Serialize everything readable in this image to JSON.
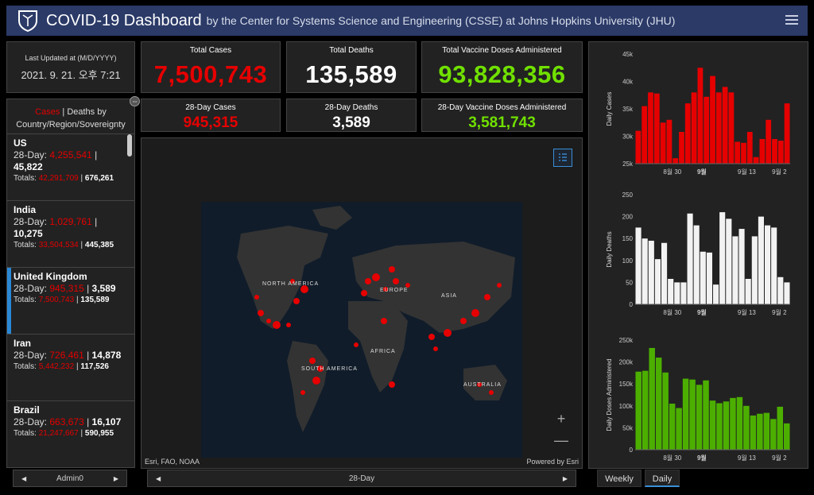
{
  "header": {
    "title": "COVID-19 Dashboard",
    "subtitle": "by the Center for Systems Science and Engineering (CSSE) at Johns Hopkins University (JHU)"
  },
  "last_updated": {
    "label": "Last Updated at (M/D/YYYY)",
    "value": "2021. 9. 21. 오후 7:21"
  },
  "stats": {
    "total_cases": {
      "label": "Total Cases",
      "value": "7,500,743"
    },
    "total_deaths": {
      "label": "Total Deaths",
      "value": "135,589"
    },
    "total_vaccine": {
      "label": "Total Vaccine Doses Administered",
      "value": "93,828,356"
    },
    "cases_28": {
      "label": "28-Day Cases",
      "value": "945,315"
    },
    "deaths_28": {
      "label": "28-Day Deaths",
      "value": "3,589"
    },
    "vaccine_28": {
      "label": "28-Day Vaccine Doses Administered",
      "value": "3,581,743"
    }
  },
  "list": {
    "header_cases": "Cases",
    "header_rest": " | Deaths by Country/Region/Sovereignty",
    "countries": [
      {
        "name": "US",
        "day28_label": "28-Day: ",
        "day28_cases": "4,255,541",
        "day28_deaths": "45,822",
        "totals_label": "Totals: ",
        "total_cases": "42,291,709",
        "total_deaths": "676,261"
      },
      {
        "name": "India",
        "day28_label": "28-Day: ",
        "day28_cases": "1,029,761",
        "day28_deaths": "10,275",
        "totals_label": "Totals: ",
        "total_cases": "33,504,534",
        "total_deaths": "445,385"
      },
      {
        "name": "United Kingdom",
        "day28_label": "28-Day: ",
        "day28_cases": "945,315",
        "day28_deaths": "3,589",
        "totals_label": "Totals: ",
        "total_cases": "7,500,743",
        "total_deaths": "135,589"
      },
      {
        "name": "Iran",
        "day28_label": "28-Day: ",
        "day28_cases": "726,461",
        "day28_deaths": "14,878",
        "totals_label": "Totals: ",
        "total_cases": "5,442,232",
        "total_deaths": "117,526"
      },
      {
        "name": "Brazil",
        "day28_label": "28-Day: ",
        "day28_cases": "663,673",
        "day28_deaths": "16,107",
        "totals_label": "Totals: ",
        "total_cases": "21,247,667",
        "total_deaths": "590,955"
      }
    ]
  },
  "left_pager": {
    "label": "Admin0"
  },
  "map_pager": {
    "label": "28-Day"
  },
  "map": {
    "labels": [
      "NORTH AMERICA",
      "EUROPE",
      "ASIA",
      "AFRICA",
      "SOUTH AMERICA",
      "AUSTRALIA"
    ],
    "attribution": "Esri, FAO, NOAA",
    "powered_by": "Powered by Esri",
    "zoom_in": "+",
    "zoom_out": "—"
  },
  "tabs": {
    "weekly": "Weekly",
    "daily": "Daily"
  },
  "colors": {
    "cases": "#e60000",
    "deaths": "#f2f2f2",
    "vaccines": "#4caf00",
    "header": "#2b3a67",
    "accent": "#2a88d6"
  },
  "chart_data": [
    {
      "type": "bar",
      "ylabel": "Daily Cases",
      "ylim": [
        25000,
        45000
      ],
      "yticks": [
        "25k",
        "30k",
        "35k",
        "40k",
        "45k"
      ],
      "xticks": [
        "8월 30",
        "9월",
        "9월 13",
        "9월 2"
      ],
      "values": [
        31000,
        35500,
        38000,
        37800,
        32500,
        33000,
        26000,
        30800,
        36000,
        38000,
        42500,
        37200,
        41000,
        38000,
        39000,
        38000,
        29000,
        28800,
        30800,
        26200,
        29500,
        33000,
        29500,
        29200,
        36000
      ]
    },
    {
      "type": "bar",
      "ylabel": "Daily Deaths",
      "ylim": [
        0,
        250
      ],
      "yticks": [
        "0",
        "50",
        "100",
        "150",
        "200",
        "250"
      ],
      "xticks": [
        "8월 30",
        "9월",
        "9월 13",
        "9월 2"
      ],
      "values": [
        175,
        150,
        145,
        103,
        140,
        58,
        50,
        50,
        207,
        180,
        120,
        118,
        45,
        210,
        195,
        155,
        172,
        58,
        155,
        200,
        180,
        175,
        62,
        50
      ]
    },
    {
      "type": "bar",
      "ylabel": "Daily Doses Administered",
      "ylim": [
        0,
        250000
      ],
      "yticks": [
        "0",
        "50k",
        "100k",
        "150k",
        "200k",
        "250k"
      ],
      "xticks": [
        "8월 30",
        "9월",
        "9월 13",
        "9월 2"
      ],
      "values": [
        178000,
        180000,
        232000,
        210000,
        176000,
        105000,
        95000,
        162000,
        160000,
        148000,
        158000,
        112000,
        106000,
        110000,
        118000,
        120000,
        100000,
        78000,
        82000,
        84000,
        70000,
        98000,
        60000
      ]
    }
  ]
}
